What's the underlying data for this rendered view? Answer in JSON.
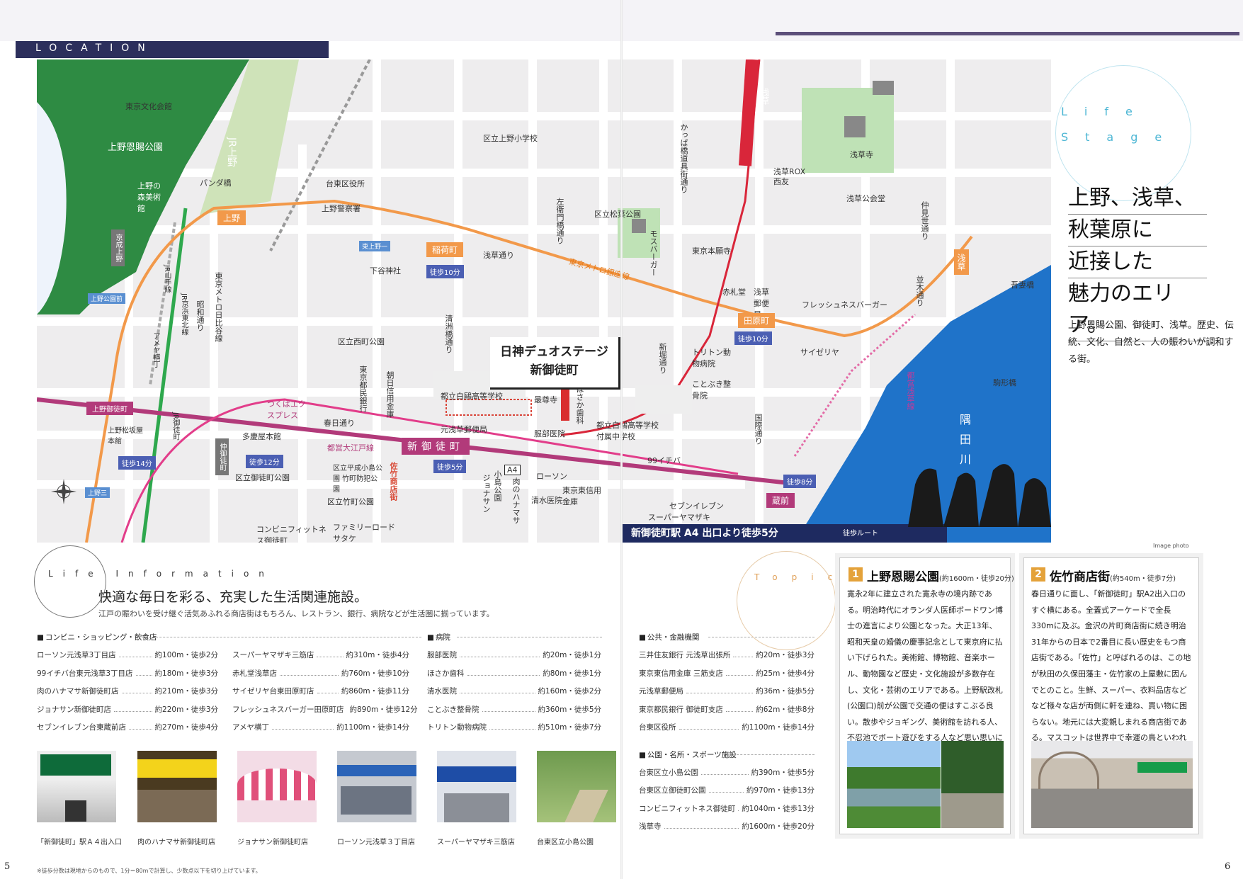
{
  "header": {
    "location_label": "LOCATION"
  },
  "map": {
    "property_name_line1": "日神デュオステージ",
    "property_name_line2": "新御徒町",
    "route_bar": "新御徒町駅 A4 出口より徒歩5分",
    "route_legend": "徒歩ルート",
    "image_photo": "Image photo",
    "labels": {
      "tokyo_bunka": "東京文化会館",
      "ueno_park": "上野恩賜公園",
      "ueno_museum": "上野の森美術館",
      "jr_ueno": "JR上野",
      "panda_bridge": "パンダ橋",
      "ueno_sta": "上野",
      "keisei_ueno": "京成上野",
      "ueno_koen_mae": "上野公園前",
      "jr_yamanote": "JR山手線",
      "jr_keihin": "JR京浜東北線",
      "ameya": "アメヤ横丁",
      "hibiya": "東京メトロ日比谷線",
      "showa": "昭和通り",
      "ueno_okachimachi": "上野御徒町",
      "ueno_matsuzakaya": "上野松坂屋本館",
      "jr_okachimachi": "JR御徒町",
      "nakaokachimachi": "仲御徒町",
      "ueno_3": "上野三",
      "taito_office": "台東区役所",
      "ueno_police": "上野警察署",
      "shitaya_sta": "下谷神社",
      "higashi_ueno": "東上野一",
      "inaricho": "稲荷町",
      "asakusa_dori": "浅草通り",
      "ueno_elem": "区立上野小学校",
      "nishimachi_park": "区立西町公園",
      "kiyosu": "清洲橋通り",
      "tokyo_tomin": "東京都民銀行",
      "asahi_shinkin": "朝日信用金庫",
      "kasuga": "春日通り",
      "tayama": "多慶屋本館",
      "okachimachi_park": "区立御徒町公園",
      "takemachi_park": "区立竹町公園",
      "heisei": "区立平成小島公園 竹町防犯公園",
      "tsukuba": "つくばエクスプレス",
      "oedo": "都営大江戸線",
      "satake_street": "佐竹商店街",
      "shinokachimachi": "新御徒町",
      "motoasakusa_post": "元浅草郵便局",
      "hakuo_high": "都立白鷗高等学校",
      "hakuo_jhs": "都立白鷗高等学校付属中学校",
      "saiho_ji": "最尊寺",
      "hattori": "服部医院",
      "hosaka": "ほさか歯科",
      "lawson": "ローソン",
      "shimizu": "清水医院",
      "tokyo_higashi": "東京東信用金庫",
      "kojima_park": "小島公園",
      "nikuno": "肉のハナマサ",
      "jonathan": "ジョナサン",
      "conv_fitness": "コンビニフィットネス御徒町",
      "family_mart": "ファミリーロードサタケ",
      "kappabashi": "かっぱ橋道具街通り",
      "sakai_inari": "左衛門橋通り",
      "matsugaya_park": "区立松葉公園",
      "mos": "モスバーガー",
      "higashihonganji": "東京本願寺",
      "akafuda": "赤札堂",
      "asakusa_post": "浅草郵便局",
      "freshness": "フレッシュネスバーガー",
      "tawaramachi": "田原町",
      "saizeriya": "サイゼリヤ",
      "triton": "トリトン動物病院",
      "kotobuki": "ことぶき整骨院",
      "kokusai": "国際通り",
      "shinbori": "新堀通り",
      "ichiba99": "99イチバ",
      "seven": "セブンイレブン",
      "yamazaki": "スーパーヤマザキ",
      "kuramae": "蔵前",
      "asakusa_temple": "浅草寺",
      "asakusa_rox": "浅草ROX",
      "seiyu": "西友",
      "asakusa_hall": "浅草公会堂",
      "nakamise": "仲見世通り",
      "nami": "並木通り",
      "azumabashi": "吾妻橋",
      "sumida": "隅田川",
      "komagata": "駒形橋",
      "asakusa_line": "都営浅草線",
      "asakusa_sta": "浅草",
      "ginza_line": "東京メトロ銀座線",
      "walk10a": "徒歩10分",
      "walk10b": "徒歩10分",
      "walk12": "徒歩12分",
      "walk14": "徒歩14分",
      "walk5": "徒歩5分",
      "walk8": "徒歩8分",
      "a4": "A4"
    }
  },
  "headline": {
    "life_stage": "Life Stage",
    "line1": "上野、浅草、",
    "line2": "秋葉原に",
    "line3": "近接した",
    "line4": "魅力のエリア。",
    "sub": "上野恩賜公園、御徒町、浅草。歴史、伝統、文化、自然と、人の賑わいが調和する街。"
  },
  "life_info": {
    "circle_label": "Life Information",
    "heading": "快適な毎日を彩る、充実した生活関連施設。",
    "sub": "江戸の賑わいを受け継ぐ活気あふれる商店街はもちろん、レストラン、銀行、病院などが生活圏に揃っています。",
    "categories": {
      "shopping": "コンビニ・ショッピング・飲食店",
      "hospital": "病院",
      "bank": "公共・金融機関",
      "park": "公園・名所・スポーツ施設"
    },
    "shopping_a": [
      {
        "name": "ローソン元浅草3丁目店",
        "dist": "約100m・徒歩2分"
      },
      {
        "name": "99イチバ台東元浅草3丁目店",
        "dist": "約180m・徒歩3分"
      },
      {
        "name": "肉のハナマサ新御徒町店",
        "dist": "約210m・徒歩3分"
      },
      {
        "name": "ジョナサン新御徒町店",
        "dist": "約220m・徒歩3分"
      },
      {
        "name": "セブンイレブン台東蔵前店",
        "dist": "約270m・徒歩4分"
      }
    ],
    "shopping_b": [
      {
        "name": "スーパーヤマザキ三筋店",
        "dist": "約310m・徒歩4分"
      },
      {
        "name": "赤札堂浅草店",
        "dist": "約760m・徒歩10分"
      },
      {
        "name": "サイゼリヤ台東田原町店",
        "dist": "約860m・徒歩11分"
      },
      {
        "name": "フレッシュネスバーガー田原町店",
        "dist": "約890m・徒歩12分"
      },
      {
        "name": "アメヤ横丁",
        "dist": "約1100m・徒歩14分"
      }
    ],
    "hospital": [
      {
        "name": "服部医院",
        "dist": "約20m・徒歩1分"
      },
      {
        "name": "ほさか歯科",
        "dist": "約80m・徒歩1分"
      },
      {
        "name": "清水医院",
        "dist": "約160m・徒歩2分"
      },
      {
        "name": "ことぶき整骨院",
        "dist": "約360m・徒歩5分"
      },
      {
        "name": "トリトン動物病院",
        "dist": "約510m・徒歩7分"
      }
    ],
    "bank": [
      {
        "name": "三井住友銀行 元浅草出張所",
        "dist": "約20m・徒歩3分"
      },
      {
        "name": "東京東信用金庫 三筋支店",
        "dist": "約25m・徒歩4分"
      },
      {
        "name": "元浅草郵便局",
        "dist": "約36m・徒歩5分"
      },
      {
        "name": "東京都民銀行 御徒町支店",
        "dist": "約62m・徒歩8分"
      },
      {
        "name": "台東区役所",
        "dist": "約1100m・徒歩14分"
      }
    ],
    "park": [
      {
        "name": "台東区立小島公園",
        "dist": "約390m・徒歩5分"
      },
      {
        "name": "台東区立御徒町公園",
        "dist": "約970m・徒歩13分"
      },
      {
        "name": "コンビニフィットネス御徒町",
        "dist": "約1040m・徒歩13分"
      },
      {
        "name": "浅草寺",
        "dist": "約1600m・徒歩20分"
      }
    ],
    "photos": [
      {
        "caption": "「新御徒町」駅Ａ４出入口"
      },
      {
        "caption": "肉のハナマサ新御徒町店"
      },
      {
        "caption": "ジョナサン新御徒町店"
      },
      {
        "caption": "ローソン元浅草３丁目店"
      },
      {
        "caption": "スーパーヤマザキ三筋店"
      },
      {
        "caption": "台東区立小島公園"
      }
    ]
  },
  "topics": {
    "label": "Topics",
    "t1": {
      "num": "1",
      "title": "上野恩賜公園",
      "meta": "(約1600m・徒歩20分)",
      "body": "寛永2年に建立された寛永寺の境内跡である。明治時代にオランダ人医師ボードワン博士の進言により公園となった。大正13年、昭和天皇の婚儀の慶事記念として東京府に払い下げられた。美術館、博物館、音楽ホール、動物園など歴史・文化施設が多数存在し、文化・芸術のエリアである。上野駅改札(公園口)前が公園で交通の便はすこぶる良い。散歩やジョギング、美術館を訪れる人、不忍池でボート遊びをする人など思い思いにこの公園を楽しんでいる。"
    },
    "t2": {
      "num": "2",
      "title": "佐竹商店街",
      "meta": "(約540m・徒歩7分)",
      "body": "春日通りに面し、「新御徒町」駅A2出入口のすぐ横にある。全蓋式アーケードで全長330mに及ぶ。金沢の片町商店街に続き明治31年からの日本で2番目に長い歴史をもつ商店街である。「佐竹」と呼ばれるのは、この地が秋田の久保田藩主・佐竹家の上屋敷に因んでとのこと。生鮮、スーパー、衣料品店などなど様々な店が両側に軒を連ね、買い物に困らない。地元には大変親しまれる商店街である。マスコットは世界中で幸運の鳥といわれている“ふくろう”だ。"
    }
  },
  "footer": {
    "page_left": "5",
    "page_right": "6",
    "note": "※徒歩分数は現地からのもので、1分＝80mで計算し、少数点以下を切り上げています。"
  },
  "colors": {
    "navy": "#2c2f5c",
    "ginza_orange": "#f2994a",
    "oedo_magenta": "#b23a7a",
    "asakusa_red": "#d9263a",
    "river_blue": "#1f73c9",
    "park_green": "#2e8b43",
    "accent_orange": "#e4a23a"
  }
}
